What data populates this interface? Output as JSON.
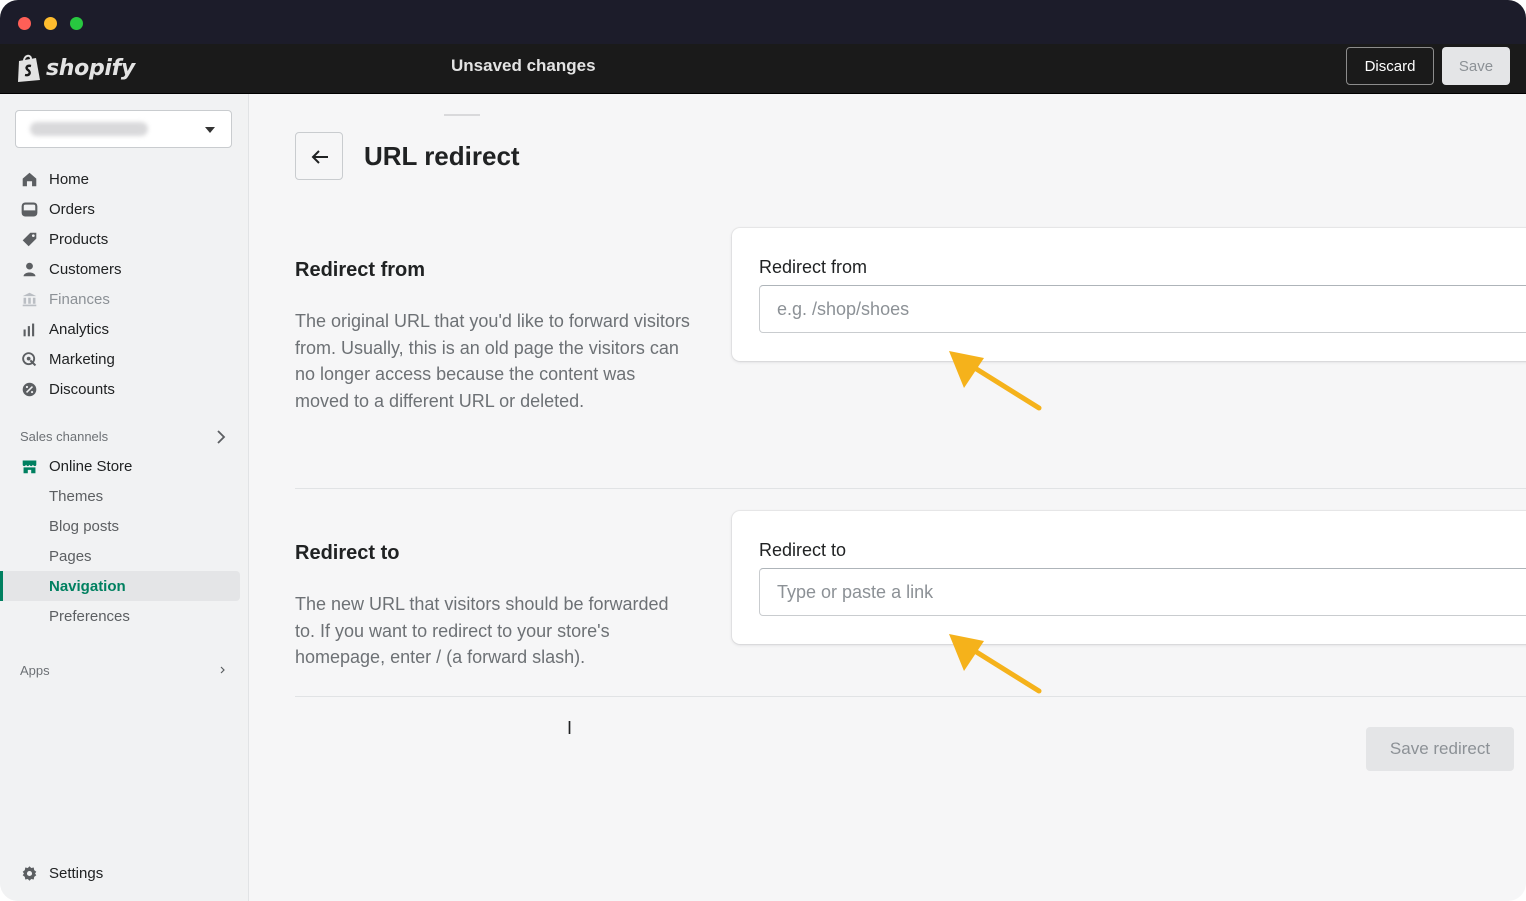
{
  "window": {
    "controls": [
      "close",
      "minimize",
      "maximize"
    ]
  },
  "topbar": {
    "logo_text": "shopify",
    "status": "Unsaved changes",
    "discard_label": "Discard",
    "save_label": "Save"
  },
  "sidebar": {
    "items": [
      {
        "label": "Home",
        "icon": "home-icon"
      },
      {
        "label": "Orders",
        "icon": "orders-icon"
      },
      {
        "label": "Products",
        "icon": "tag-icon"
      },
      {
        "label": "Customers",
        "icon": "person-icon"
      },
      {
        "label": "Finances",
        "icon": "bank-icon"
      },
      {
        "label": "Analytics",
        "icon": "bar-chart-icon"
      },
      {
        "label": "Marketing",
        "icon": "target-icon"
      },
      {
        "label": "Discounts",
        "icon": "discount-icon"
      }
    ],
    "sales_channels_title": "Sales channels",
    "online_store_label": "Online Store",
    "online_store_subitems": [
      "Themes",
      "Blog posts",
      "Pages",
      "Navigation",
      "Preferences"
    ],
    "active_subitem": "Navigation",
    "apps_title": "Apps",
    "settings_label": "Settings"
  },
  "page": {
    "title": "URL redirect",
    "redirect_from": {
      "heading": "Redirect from",
      "description": "The original URL that you'd like to forward visitors from. Usually, this is an old page the visitors can no longer access because the content was moved to a different URL or deleted.",
      "field_label": "Redirect from",
      "placeholder": "e.g. /shop/shoes"
    },
    "redirect_to": {
      "heading": "Redirect to",
      "description": "The new URL that visitors should be forwarded to. If you want to redirect to your store's homepage, enter / (a forward slash).",
      "field_label": "Redirect to",
      "placeholder": "Type or paste a link"
    },
    "save_redirect_label": "Save redirect"
  },
  "colors": {
    "accent_green": "#008060",
    "annotation_arrow": "#f5b21b",
    "topbar_bg": "#1a1a1a"
  }
}
